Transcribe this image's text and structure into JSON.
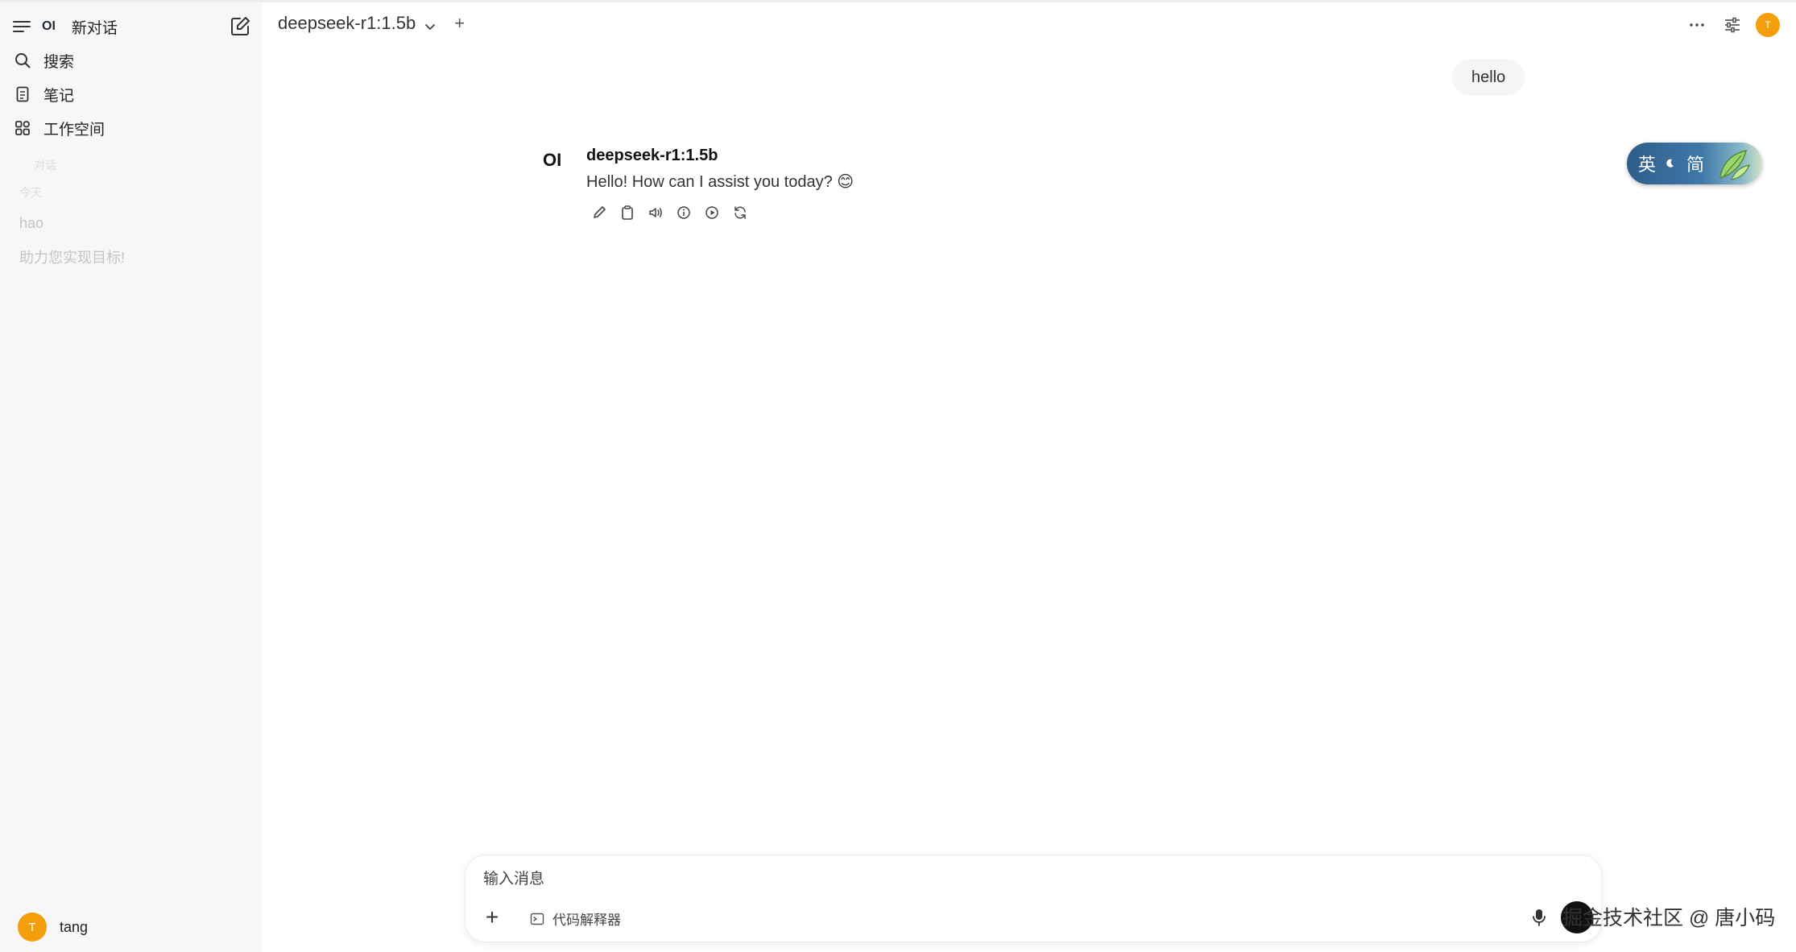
{
  "sidebar": {
    "logo": "OI",
    "new_chat": "新对话",
    "items": [
      {
        "label": "搜索",
        "icon": "search-icon"
      },
      {
        "label": "笔记",
        "icon": "notes-icon"
      },
      {
        "label": "工作空间",
        "icon": "workspace-icon"
      }
    ],
    "section_chats": "对话",
    "section_today": "今天",
    "history": [
      "hao",
      "助力您实现目标!"
    ],
    "user": {
      "initial": "T",
      "name": "tang"
    }
  },
  "header": {
    "model": "deepseek-r1:1.5b",
    "avatar_initial": "T"
  },
  "chat": {
    "user_message": "hello",
    "bot": {
      "logo": "OI",
      "name": "deepseek-r1:1.5b",
      "text": "Hello! How can I assist you today? 😊"
    }
  },
  "translate_widget": {
    "left": "英",
    "right": "简"
  },
  "input": {
    "placeholder": "输入消息",
    "code_interpreter": "代码解释器"
  },
  "watermark": "掘金技术社区 @ 唐小码",
  "colors": {
    "accent": "#f59e0b",
    "sidebar_bg": "#f7f7f7"
  }
}
